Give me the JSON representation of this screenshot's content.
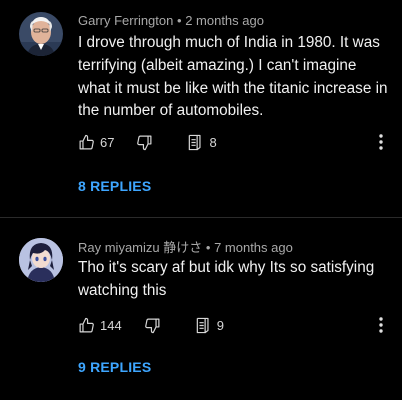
{
  "comments": [
    {
      "author": "Garry Ferrington",
      "time": "2 months ago",
      "text": "I drove through much of India in 1980. It was terrifying (albeit amazing.) I can't imagine what it must be like with the titanic increase in the number of automobiles.",
      "likes": "67",
      "reply_count": "8",
      "replies_label": "8 REPLIES",
      "avatar": "profile-photo-elderly-man"
    },
    {
      "author": "Ray miyamizu 静けさ",
      "time": "7 months ago",
      "text": "Tho it's scary af but idk why Its so satisfying watching this",
      "likes": "144",
      "reply_count": "9",
      "replies_label": "9 REPLIES",
      "avatar": "profile-anime-character"
    }
  ],
  "separator": "•",
  "colors": {
    "background": "#000000",
    "text": "#f1f1f1",
    "meta": "#a8a8a8",
    "link": "#3ea6ff",
    "divider": "#2a2a2a"
  },
  "icons": [
    "thumbs-up-icon",
    "thumbs-down-icon",
    "reply-icon",
    "more-vert-icon"
  ]
}
